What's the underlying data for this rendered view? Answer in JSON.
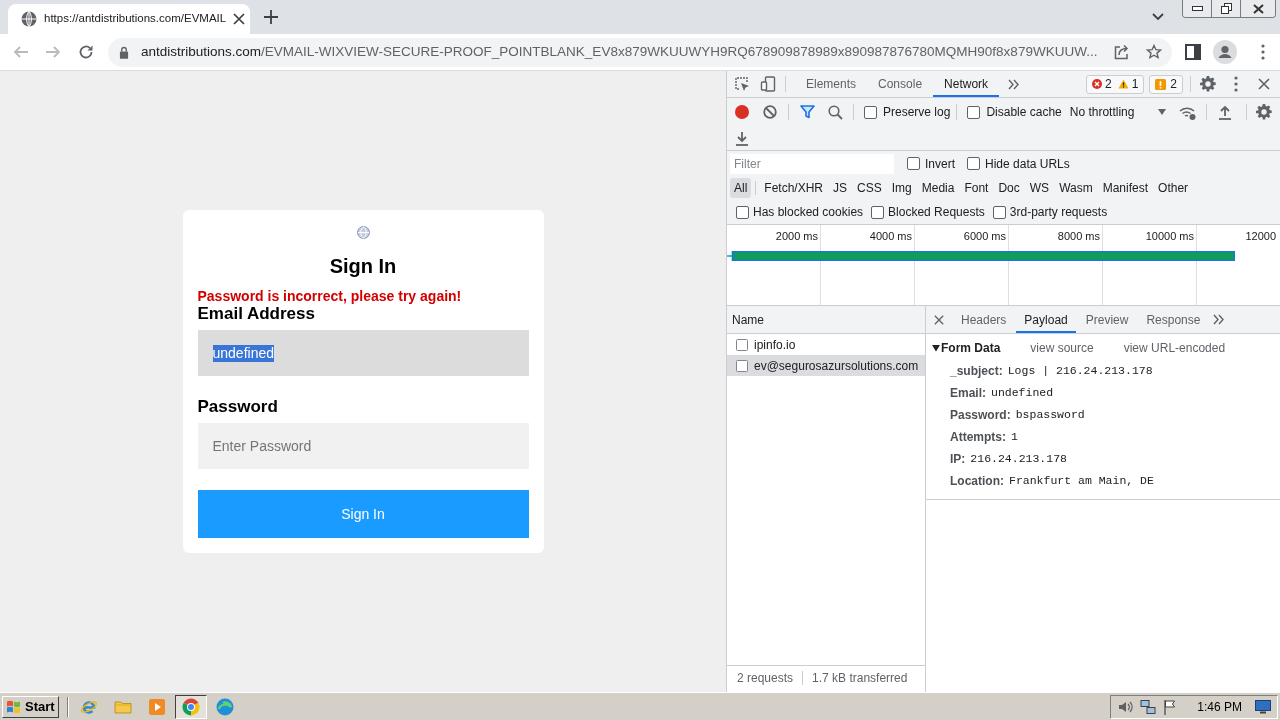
{
  "browser": {
    "tabs": [
      {
        "title": "https://antdistributions.com/EVMAIL",
        "selected": true
      }
    ],
    "back": {
      "disabled": true
    },
    "forward": {
      "disabled": true
    },
    "address": {
      "host": "antdistributions.com",
      "path": "/EVMAIL-WIXVIEW-SECURE-PROOF_POINTBLANK_EV8x879WKUUWYH9RQ678909878989x890987876780MQMH90f8x879WKUUW..."
    }
  },
  "page": {
    "title": "Sign In",
    "error": "Password is incorrect, please try again!",
    "fields": [
      {
        "kind": "email",
        "label": "Email Address",
        "value": "undefined",
        "highlighted": true
      },
      {
        "kind": "password",
        "label": "Password",
        "placeholder": "Enter Password"
      }
    ],
    "button": "Sign In"
  },
  "devtools": {
    "tabs": [
      {
        "label": "Elements",
        "selected": false
      },
      {
        "label": "Console",
        "selected": false
      },
      {
        "label": "Network",
        "selected": true
      }
    ],
    "counters": {
      "errors": "2",
      "warnings": "1",
      "issues": "2"
    },
    "network_toolbar": {
      "recording": true,
      "checkboxes": [
        {
          "label": "Preserve log",
          "checked": false
        },
        {
          "label": "Disable cache",
          "checked": false
        }
      ],
      "throttling": "No throttling"
    },
    "filter": {
      "placeholder": "Filter",
      "options": [
        {
          "label": "Invert",
          "checked": false
        },
        {
          "label": "Hide data URLs",
          "checked": false
        }
      ]
    },
    "types": [
      {
        "label": "All",
        "selected": true
      },
      {
        "label": "Fetch/XHR",
        "selected": false
      },
      {
        "label": "JS",
        "selected": false
      },
      {
        "label": "CSS",
        "selected": false
      },
      {
        "label": "Img",
        "selected": false
      },
      {
        "label": "Media",
        "selected": false
      },
      {
        "label": "Font",
        "selected": false
      },
      {
        "label": "Doc",
        "selected": false
      },
      {
        "label": "WS",
        "selected": false
      },
      {
        "label": "Wasm",
        "selected": false
      },
      {
        "label": "Manifest",
        "selected": false
      },
      {
        "label": "Other",
        "selected": false
      }
    ],
    "request_options": [
      {
        "label": "Has blocked cookies",
        "checked": false
      },
      {
        "label": "Blocked Requests",
        "checked": false
      },
      {
        "label": "3rd-party requests",
        "checked": false
      }
    ],
    "overview": {
      "ticks": [
        "2000 ms",
        "4000 ms",
        "6000 ms",
        "8000 ms",
        "10000 ms",
        "12000"
      ]
    },
    "requests": {
      "column": "Name",
      "rows": [
        {
          "name": "ipinfo.io",
          "selected": false
        },
        {
          "name": "ev@segurosazursolutions.com",
          "selected": true
        }
      ]
    },
    "detail_tabs": [
      {
        "label": "Headers",
        "selected": false
      },
      {
        "label": "Payload",
        "selected": true
      },
      {
        "label": "Preview",
        "selected": false
      },
      {
        "label": "Response",
        "selected": false
      }
    ],
    "form_data": {
      "title": "Form Data",
      "expanded": true,
      "links": [
        "view source",
        "view URL-encoded"
      ],
      "fields": [
        {
          "key": "_subject:",
          "value": "Logs | 216.24.213.178"
        },
        {
          "key": "Email:",
          "value": "undefined"
        },
        {
          "key": "Password:",
          "value": "bspassword"
        },
        {
          "key": "Attempts:",
          "value": "1"
        },
        {
          "key": "IP:",
          "value": "216.24.213.178"
        },
        {
          "key": "Location:",
          "value": "Frankfurt am Main, DE"
        }
      ]
    },
    "status": [
      "2 requests",
      "1.7 kB transferred"
    ]
  },
  "taskbar": {
    "start": "Start",
    "apps": [
      {
        "kind": "ie",
        "selected": false
      },
      {
        "kind": "folder",
        "selected": false
      },
      {
        "kind": "media",
        "selected": false
      },
      {
        "kind": "chrome",
        "selected": true
      },
      {
        "kind": "edge",
        "selected": false
      }
    ],
    "clock": "1:46 PM"
  }
}
